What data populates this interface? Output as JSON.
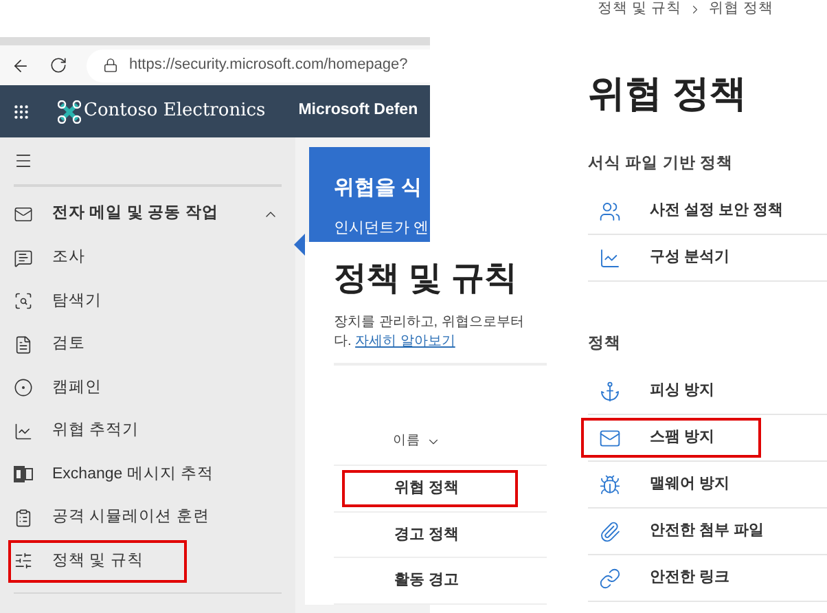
{
  "browser": {
    "url": "https://security.microsoft.com/homepage?"
  },
  "header": {
    "brand": "Contoso Electronics",
    "product": "Microsoft Defen"
  },
  "sidebar": {
    "section": {
      "label": "전자 메일 및 공동 작업",
      "expanded": true
    },
    "items": [
      {
        "label": "조사",
        "highlighted": false
      },
      {
        "label": "탐색기",
        "highlighted": false
      },
      {
        "label": "검토",
        "highlighted": false
      },
      {
        "label": "캠페인",
        "highlighted": false
      },
      {
        "label": "위협 추적기",
        "highlighted": false
      },
      {
        "label": "Exchange 메시지 추적",
        "highlighted": false
      },
      {
        "label": "공격 시뮬레이션 훈련",
        "highlighted": false
      },
      {
        "label": "정책 및 규칙",
        "highlighted": true
      }
    ]
  },
  "banner": {
    "title": "위협을 식",
    "text": "인시던트가 엔"
  },
  "popup": {
    "title": "정책 및 규칙",
    "description": "장치를 관리하고, 위협으로부터",
    "description_end": "다.",
    "link": "자세히 알아보기",
    "column": "이름",
    "rows": [
      {
        "label": "위협 정책",
        "highlighted": true
      },
      {
        "label": "경고 정책",
        "highlighted": false
      },
      {
        "label": "활동 경고",
        "highlighted": false
      }
    ]
  },
  "page": {
    "breadcrumb": [
      "정책 및 규칙",
      "위협 정책"
    ],
    "title": "위협 정책",
    "sections": [
      {
        "heading": "서식 파일 기반 정책",
        "items": [
          {
            "label": "사전 설정 보안 정책",
            "highlighted": false
          },
          {
            "label": "구성 분석기",
            "highlighted": false
          }
        ]
      },
      {
        "heading": "정책",
        "items": [
          {
            "label": "피싱 방지",
            "highlighted": false
          },
          {
            "label": "스팸 방지",
            "highlighted": true
          },
          {
            "label": "맬웨어 방지",
            "highlighted": false
          },
          {
            "label": "안전한 첨부 파일",
            "highlighted": false
          },
          {
            "label": "안전한 링크",
            "highlighted": false
          }
        ]
      }
    ]
  }
}
